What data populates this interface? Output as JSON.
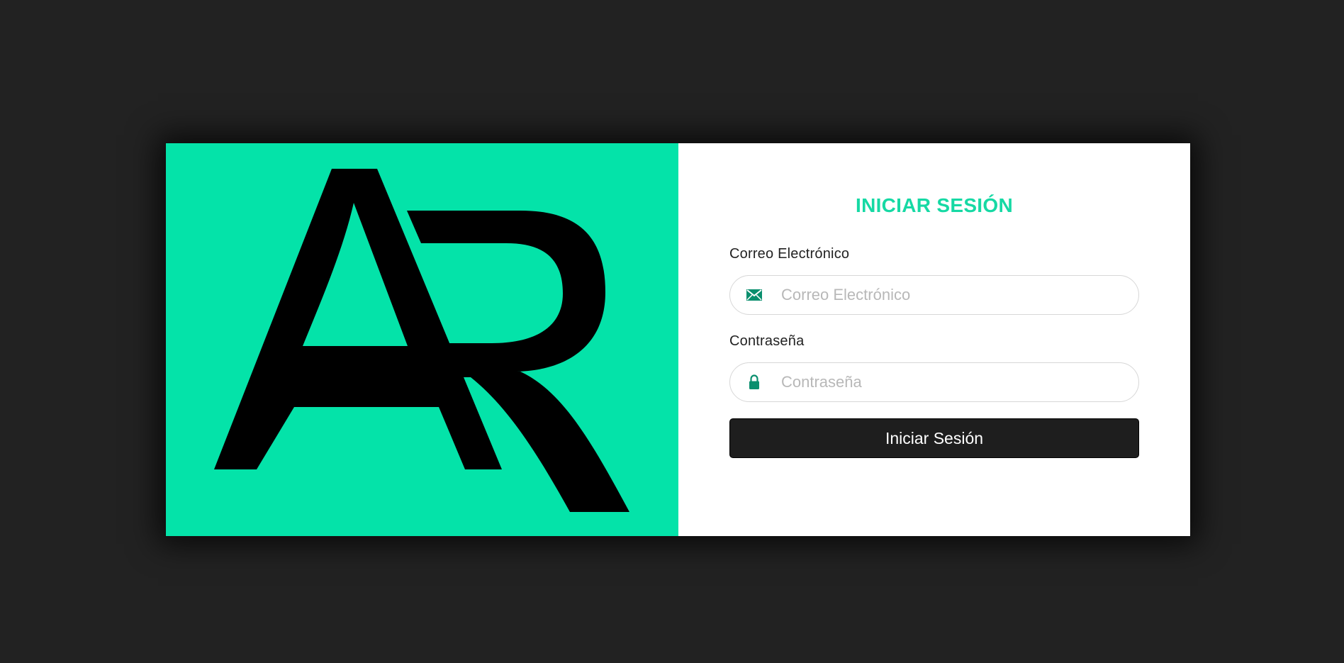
{
  "brand": {
    "logo_text": "AR",
    "background_color": "#04e3a9"
  },
  "login": {
    "title": "INICIAR SESIÓN",
    "email_label": "Correo Electrónico",
    "email_placeholder": "Correo Electrónico",
    "email_value": "",
    "email_icon": "envelope-icon",
    "password_label": "Contraseña",
    "password_placeholder": "Contraseña",
    "password_value": "",
    "password_icon": "lock-icon",
    "submit_label": "Iniciar Sesión",
    "accent_color": "#16d9a4",
    "button_color": "#1e1e1e"
  }
}
